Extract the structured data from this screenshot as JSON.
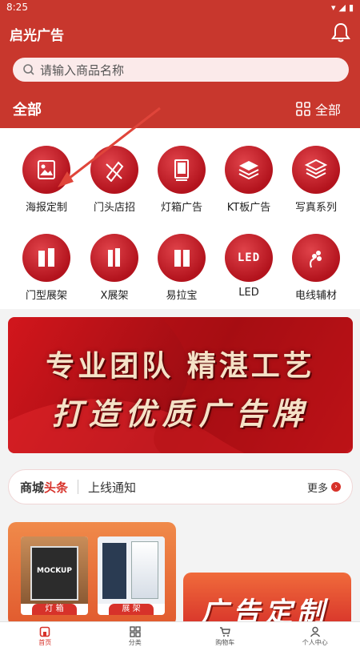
{
  "status": {
    "time": "8:25"
  },
  "header": {
    "title": "启光广告",
    "search_placeholder": "请输入商品名称",
    "section_title": "全部",
    "all_label": "全部"
  },
  "categories": [
    {
      "label": "海报定制",
      "icon": "poster-icon"
    },
    {
      "label": "门头店招",
      "icon": "storefront-sign-icon"
    },
    {
      "label": "灯箱广告",
      "icon": "lightbox-icon"
    },
    {
      "label": "KT板广告",
      "icon": "kt-board-icon"
    },
    {
      "label": "写真系列",
      "icon": "print-layers-icon"
    },
    {
      "label": "门型展架",
      "icon": "door-stand-icon"
    },
    {
      "label": "X展架",
      "icon": "x-stand-icon"
    },
    {
      "label": "易拉宝",
      "icon": "rollup-banner-icon"
    },
    {
      "label": "LED",
      "icon": "led-icon"
    },
    {
      "label": "电线辅材",
      "icon": "cable-icon"
    }
  ],
  "banner": {
    "line1": "专业团队  精湛工艺",
    "line2": "打造优质广告牌"
  },
  "news": {
    "brand_prefix": "商城",
    "brand_highlight": "头条",
    "text": "上线通知",
    "more": "更多"
  },
  "promo": {
    "card1_tag": "灯 箱",
    "card1_mockup": "MOCKUP",
    "card2_tag": "展 架",
    "right_title": "广告定制"
  },
  "tabbar": [
    {
      "label": "首页",
      "icon": "home-icon",
      "active": true
    },
    {
      "label": "分类",
      "icon": "grid-icon",
      "active": false
    },
    {
      "label": "购物车",
      "icon": "cart-icon",
      "active": false
    },
    {
      "label": "个人中心",
      "icon": "user-icon",
      "active": false
    }
  ],
  "colors": {
    "brand": "#c8372d",
    "accent": "#d7322a"
  }
}
